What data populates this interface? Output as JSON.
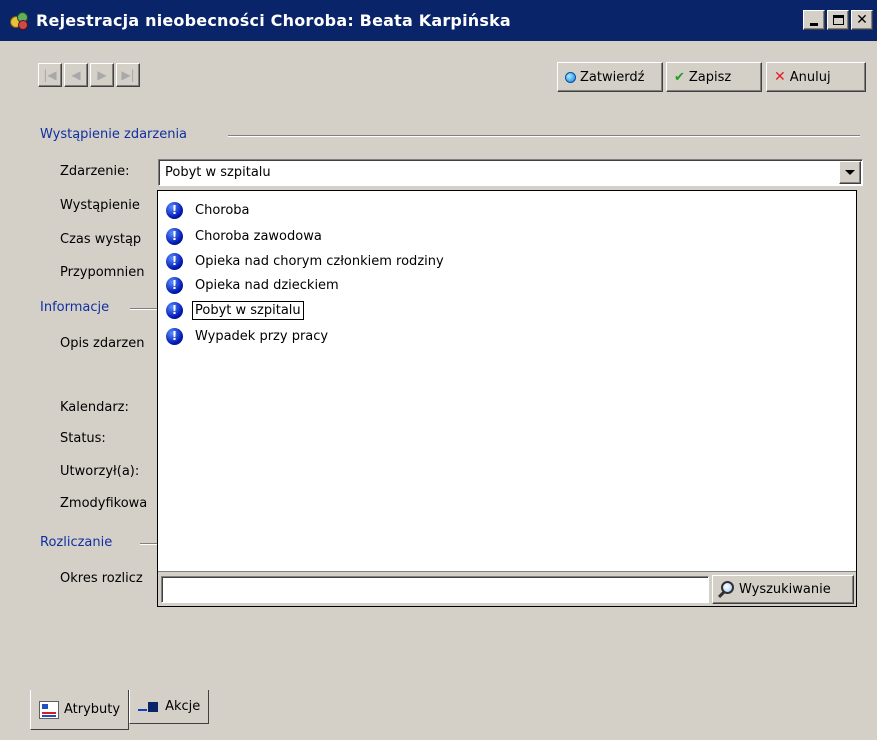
{
  "window": {
    "title": "Rejestracja nieobecności Choroba: Beata Karpińska",
    "controls": [
      "_",
      "□",
      "×"
    ]
  },
  "toolbar": {
    "nav_icons": [
      "first-record-icon",
      "previous-record-icon",
      "next-record-icon",
      "last-record-icon"
    ],
    "confirm_label": "Zatwierdź",
    "save_label": "Zapisz",
    "cancel_label": "Anuluj"
  },
  "sections": {
    "occurrence": "Wystąpienie zdarzenia",
    "information": "Informacje",
    "settlement": "Rozliczanie"
  },
  "fields": {
    "event_label": "Zdarzenie:",
    "occurrence_label": "Wystąpienie",
    "occurrence_time_label": "Czas wystąp",
    "reminder_label": "Przypomnien",
    "description_label": "Opis zdarzen",
    "calendar_label": "Kalendarz:",
    "status_label": "Status:",
    "created_by_label": "Utworzył(a):",
    "modified_by_label": "Zmodyfikowa",
    "period_label": "Okres rozlicz"
  },
  "event_combo": {
    "value": "Pobyt w szpitalu"
  },
  "dropdown": {
    "items": [
      {
        "label": "Choroba",
        "icon": "info-icon"
      },
      {
        "label": "Choroba zawodowa",
        "icon": "info-icon"
      },
      {
        "label": "Opieka nad chorym członkiem rodziny",
        "icon": "info-icon"
      },
      {
        "label": "Opieka nad dzieckiem",
        "icon": "info-icon"
      },
      {
        "label": "Pobyt w szpitalu",
        "icon": "info-icon",
        "selected": true
      },
      {
        "label": "Wypadek przy pracy",
        "icon": "info-icon"
      }
    ],
    "search_value": "",
    "search_button": "Wyszukiwanie"
  },
  "tabs": [
    {
      "label": "Atrybuty",
      "icon": "attributes-icon",
      "active": true
    },
    {
      "label": "Akcje",
      "icon": "actions-icon",
      "active": false
    }
  ]
}
